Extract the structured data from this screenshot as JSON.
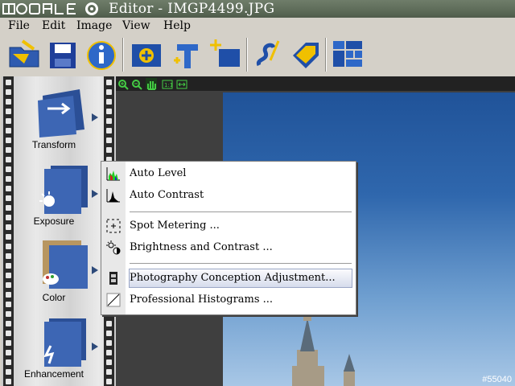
{
  "window": {
    "title": "Editor  - IMGP4499.JPG"
  },
  "menu": [
    "File",
    "Edit",
    "Image",
    "View",
    "Help"
  ],
  "toolbar": {
    "icons": [
      "open-icon",
      "save-icon",
      "info-icon",
      "capture-icon",
      "text-icon",
      "frame-icon",
      "sign-icon",
      "tag-icon",
      "layout-icon"
    ]
  },
  "tools": [
    {
      "label": "Transform"
    },
    {
      "label": "Exposure"
    },
    {
      "label": "Color"
    },
    {
      "label": "Enhancement"
    }
  ],
  "context_menu": {
    "items": [
      {
        "label": "Auto Level",
        "icon": "histogram-icon"
      },
      {
        "label": "Auto Contrast",
        "icon": "histogram-icon"
      },
      {
        "label": "Spot Metering ...",
        "icon": "spot-metering-icon"
      },
      {
        "label": "Brightness and Contrast ...",
        "icon": "brightness-icon"
      },
      {
        "label": "Photography Conception Adjustment...",
        "icon": "film-icon",
        "selected": true
      },
      {
        "label": "Professional Histograms ...",
        "icon": "curve-icon"
      }
    ]
  },
  "canvas": {
    "watermark": "#55040"
  },
  "colors": {
    "titlebar": "#5d6b58",
    "accent": "#2d4a7a",
    "sky": "#2f67ad"
  }
}
